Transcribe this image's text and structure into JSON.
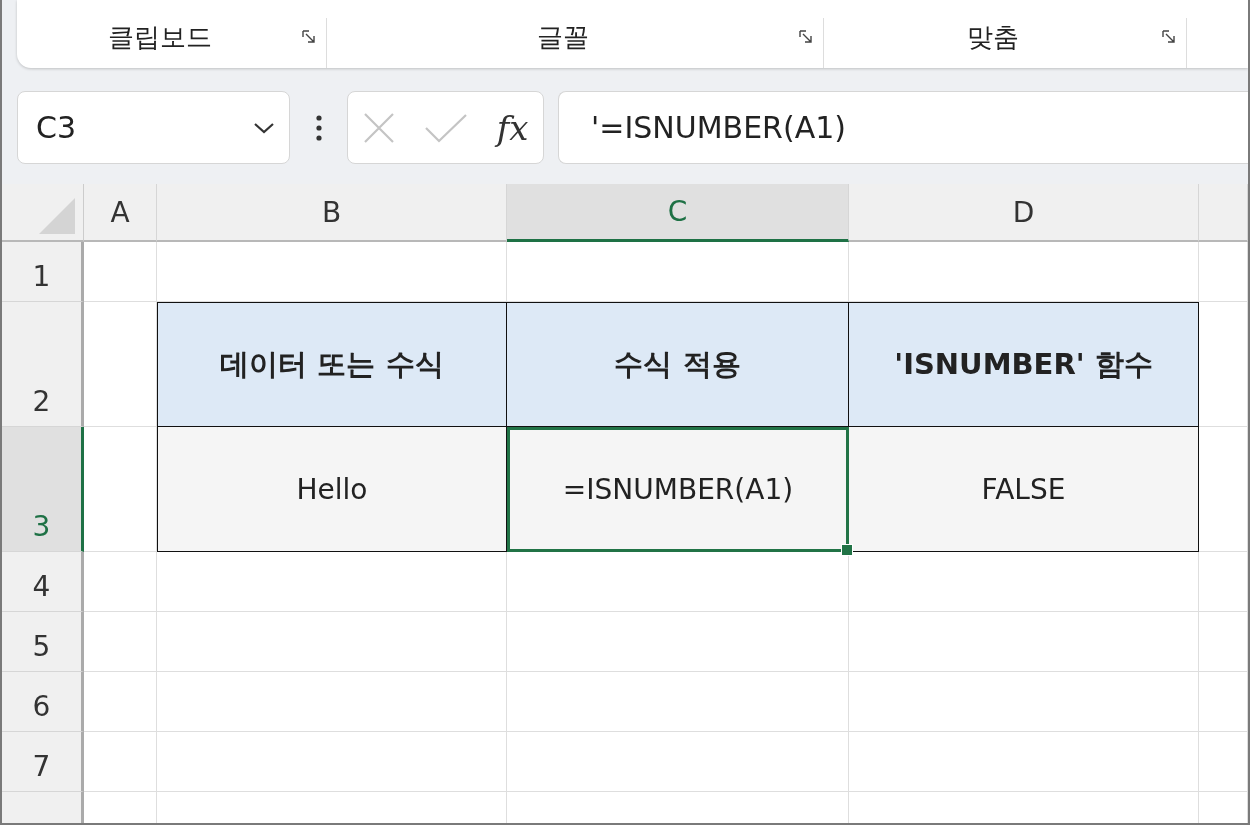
{
  "ribbon": {
    "groups": [
      "클립보드",
      "글꼴",
      "맞춤"
    ]
  },
  "name_box": {
    "value": "C3"
  },
  "formula_bar": {
    "function_label": "fx",
    "value": "'=ISNUMBER(A1)"
  },
  "sheet": {
    "columns": [
      {
        "label": "A",
        "selected": false
      },
      {
        "label": "B",
        "selected": false
      },
      {
        "label": "C",
        "selected": true
      },
      {
        "label": "D",
        "selected": false
      }
    ],
    "rows": [
      {
        "label": "1",
        "selected": false
      },
      {
        "label": "2",
        "selected": false
      },
      {
        "label": "3",
        "selected": true
      },
      {
        "label": "4",
        "selected": false
      },
      {
        "label": "5",
        "selected": false
      },
      {
        "label": "6",
        "selected": false
      },
      {
        "label": "7",
        "selected": false
      }
    ],
    "data_table": {
      "header": [
        "데이터 또는 수식",
        "수식 적용",
        "'ISNUMBER' 함수"
      ],
      "rows": [
        [
          {
            "text": "Hello",
            "selected": false
          },
          {
            "text": "=ISNUMBER(A1)",
            "selected": true
          },
          {
            "text": "FALSE",
            "selected": false
          }
        ]
      ]
    }
  }
}
